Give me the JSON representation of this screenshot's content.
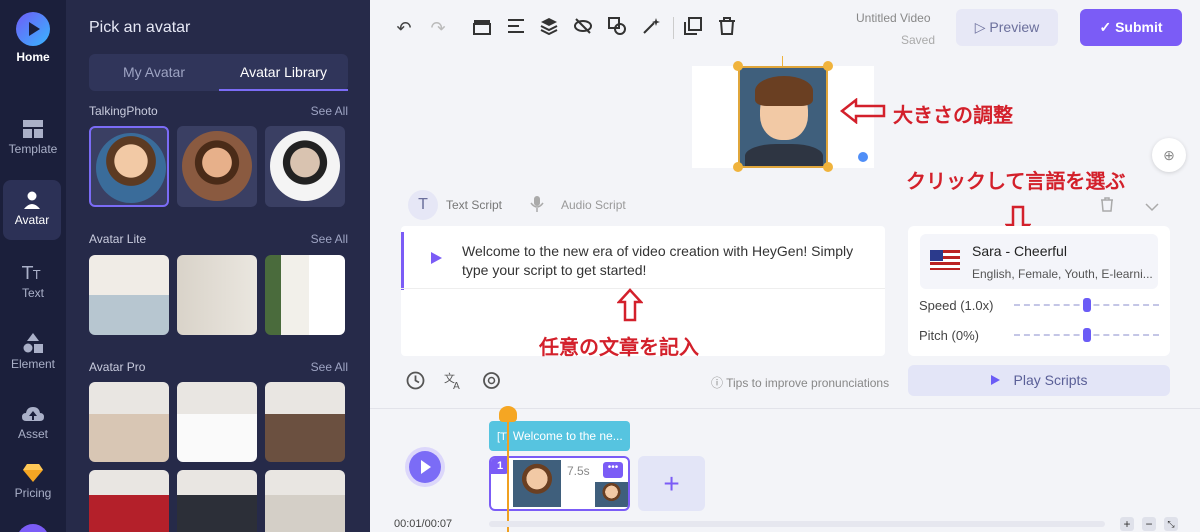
{
  "rail": {
    "home": "Home",
    "items": [
      {
        "label": "Template",
        "icon": "template-icon"
      },
      {
        "label": "Avatar",
        "icon": "avatar-icon"
      },
      {
        "label": "Text",
        "icon": "text-icon"
      },
      {
        "label": "Element",
        "icon": "element-icon"
      },
      {
        "label": "Asset",
        "icon": "asset-icon"
      },
      {
        "label": "Pricing",
        "icon": "pricing-icon"
      }
    ]
  },
  "panel": {
    "title": "Pick an avatar",
    "tabs": [
      "My Avatar",
      "Avatar Library"
    ],
    "sections": [
      {
        "title": "TalkingPhoto",
        "see_all": "See All"
      },
      {
        "title": "Avatar Lite",
        "see_all": "See All"
      },
      {
        "title": "Avatar Pro",
        "see_all": "See All"
      }
    ]
  },
  "toolbar": {
    "video_title": "Untitled Video",
    "saved": "Saved",
    "preview": "Preview",
    "submit": "Submit"
  },
  "script": {
    "text_tab": "Text Script",
    "audio_tab": "Audio Script",
    "text": "Welcome to the new era of video creation with HeyGen! Simply type your script to get started!",
    "tips": "Tips to improve pronunciations"
  },
  "voice": {
    "name": "Sara - Cheerful",
    "desc": "English, Female, Youth, E-learni...",
    "speed_label": "Speed (1.0x)",
    "pitch_label": "Pitch (0%)",
    "play_scripts": "Play Scripts"
  },
  "timeline": {
    "text_clip": "Welcome to the ne...",
    "clip_number": "1",
    "clip_duration": "7.5s",
    "time": "00:01/00:07"
  },
  "annotations": {
    "resize": "大きさの調整",
    "language": "クリックして言語を選ぶ",
    "text": "任意の文章を記入"
  },
  "colors": {
    "accent": "#7b5cf6",
    "rail_bg": "#1b1f3b",
    "panel_bg": "#262a49",
    "annotation": "#d3202b"
  }
}
